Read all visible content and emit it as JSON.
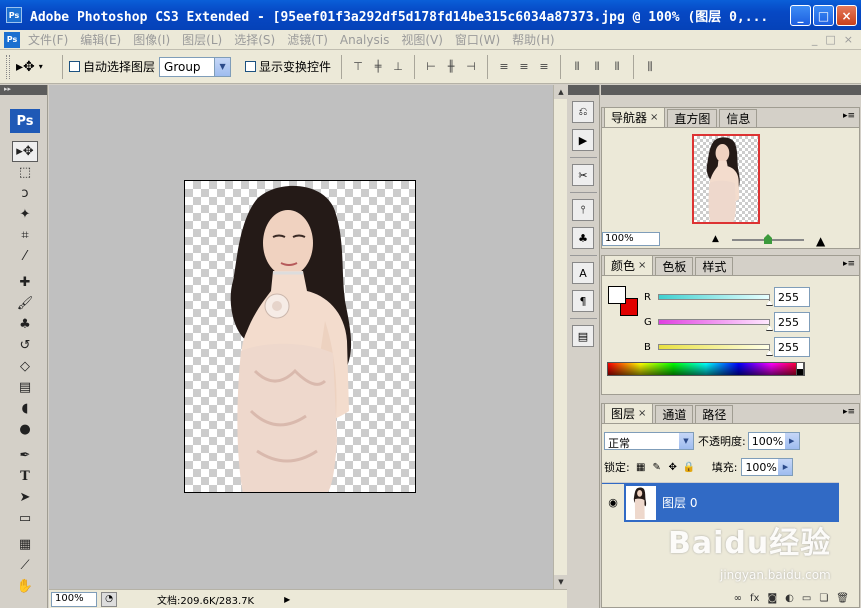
{
  "window": {
    "title": "Adobe Photoshop CS3 Extended - [95eef01f3a292df5d178fd14be315c6034a87373.jpg @ 100% (图层 0,...",
    "logo": "Ps",
    "buttons": [
      "_",
      "□",
      "×"
    ]
  },
  "menu": {
    "items": [
      "文件(F)",
      "编辑(E)",
      "图像(I)",
      "图层(L)",
      "选择(S)",
      "滤镜(T)",
      "Analysis",
      "视图(V)",
      "窗口(W)",
      "帮助(H)"
    ],
    "right_controls": [
      "_",
      "□",
      "×"
    ]
  },
  "options": {
    "auto_select_label": "自动选择图层",
    "auto_select_value": "Group",
    "transform_label": "显示变换控件"
  },
  "toolbox": {
    "logo": "Ps",
    "tools": [
      "move-tool",
      "marquee-tool",
      "lasso-tool",
      "magic-wand-tool",
      "crop-tool",
      "slice-tool",
      "healing-brush-tool",
      "brush-tool",
      "clone-stamp-tool",
      "history-brush-tool",
      "eraser-tool",
      "gradient-tool",
      "blur-tool",
      "dodge-tool",
      "pen-tool",
      "type-tool",
      "path-selection-tool",
      "shape-tool",
      "notes-tool",
      "eyedropper-tool",
      "hand-tool"
    ]
  },
  "status": {
    "zoom": "100%",
    "doc_info": "文档:209.6K/283.7K"
  },
  "navigator": {
    "tabs": [
      "导航器",
      "直方图",
      "信息"
    ],
    "zoom": "100%"
  },
  "color_panel": {
    "tabs": [
      "颜色",
      "色板",
      "样式"
    ],
    "channels": [
      {
        "label": "R",
        "value": "255",
        "color": "#3fd0d0"
      },
      {
        "label": "G",
        "value": "255",
        "color": "#e040e0"
      },
      {
        "label": "B",
        "value": "255",
        "color": "#e8e040"
      }
    ],
    "foreground": "#ffffff",
    "background": "#e10000"
  },
  "layers_panel": {
    "tabs": [
      "图层",
      "通道",
      "路径"
    ],
    "blend_mode": "正常",
    "opacity_label": "不透明度:",
    "opacity_value": "100%",
    "lock_label": "锁定:",
    "fill_label": "填充:",
    "fill_value": "100%",
    "layers": [
      {
        "name": "图层 0",
        "visible": true,
        "selected": true
      }
    ]
  },
  "watermark": {
    "text": "Baidu经验",
    "sub": "jingyan.baidu.com"
  }
}
